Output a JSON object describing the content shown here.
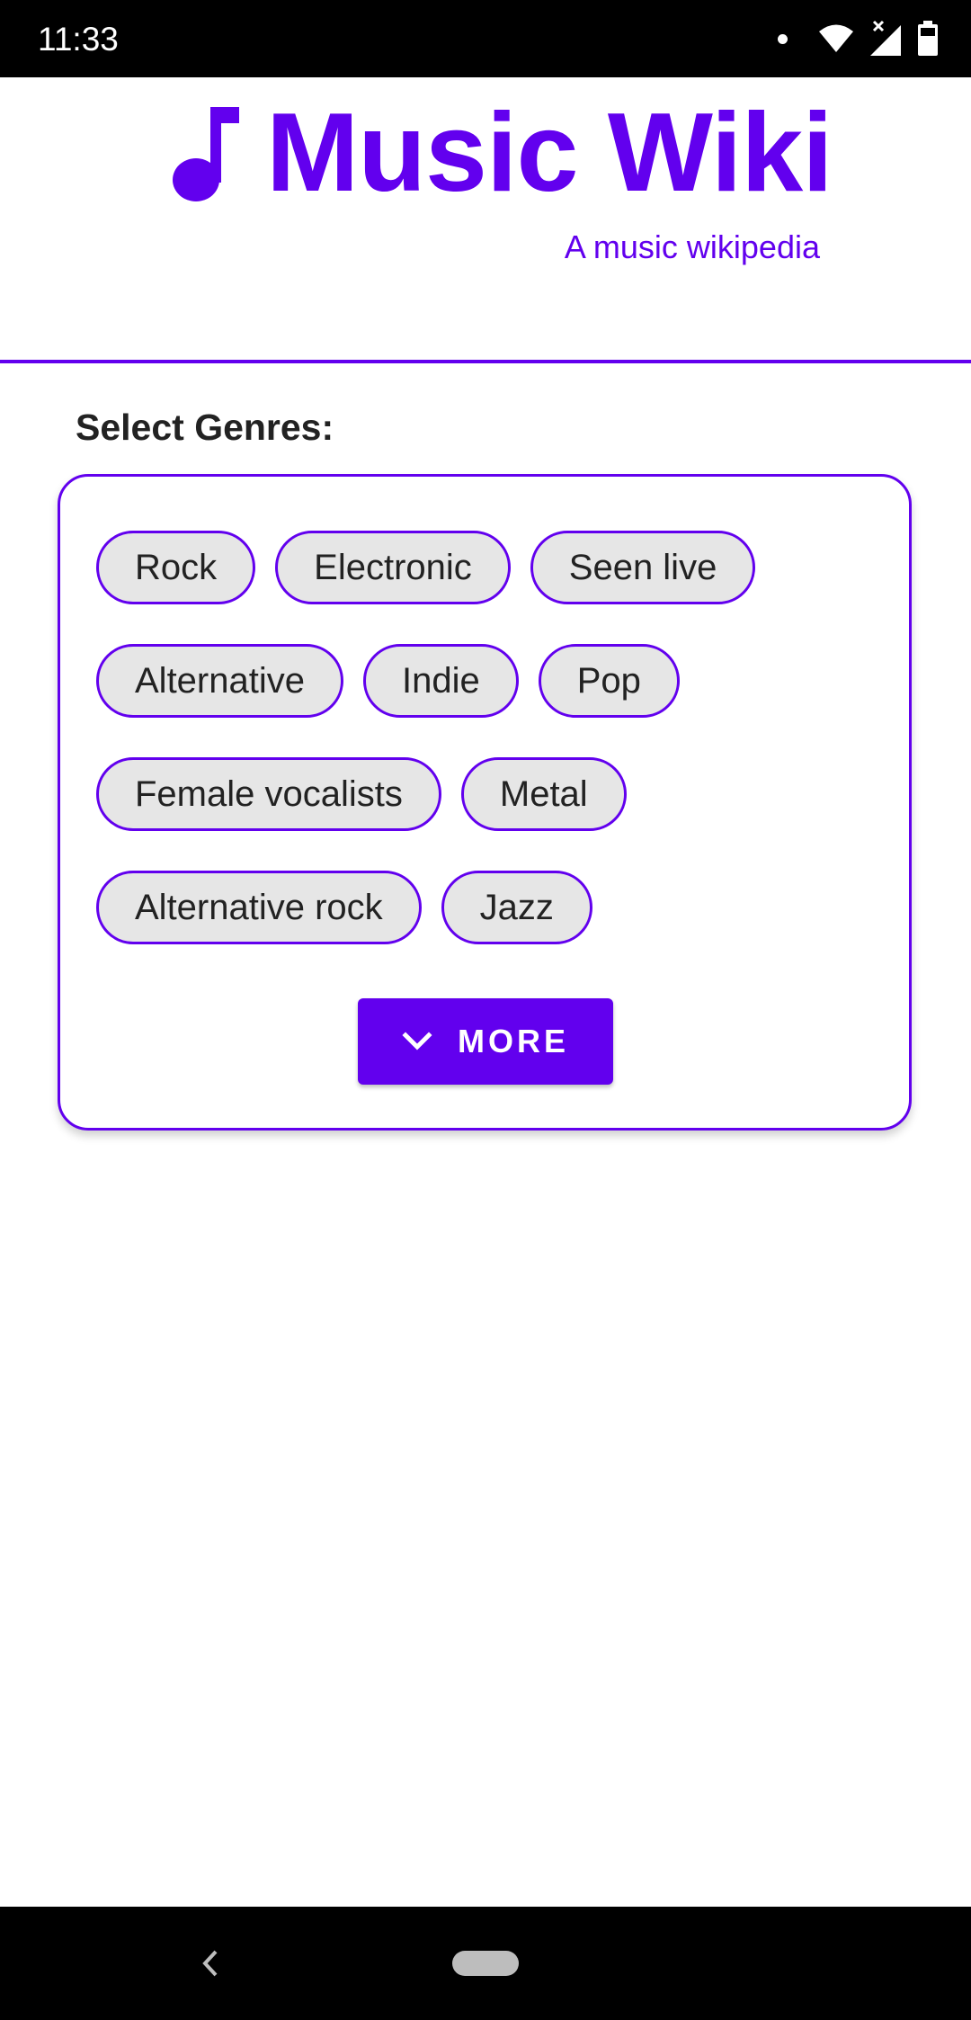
{
  "status_bar": {
    "time": "11:33",
    "icons": [
      "notification-dot-icon",
      "wifi-icon",
      "signal-icon",
      "battery-icon"
    ]
  },
  "header": {
    "icon": "music-note-icon",
    "title": "Music Wiki",
    "subtitle": "A music wikipedia"
  },
  "genres": {
    "label": "Select Genres:",
    "rows": [
      [
        "Rock",
        "Electronic",
        "Seen live"
      ],
      [
        "Alternative",
        "Indie",
        "Pop"
      ],
      [
        "Female vocalists",
        "Metal"
      ],
      [
        "Alternative rock",
        "Jazz"
      ]
    ],
    "more_button": {
      "icon": "chevron-down-icon",
      "label": "MORE"
    }
  },
  "colors": {
    "accent": "#6200ee",
    "chip_background": "#e6e6e6",
    "text": "#222222"
  },
  "nav_bar": {
    "icons": [
      "back-icon",
      "home-pill-icon"
    ]
  }
}
